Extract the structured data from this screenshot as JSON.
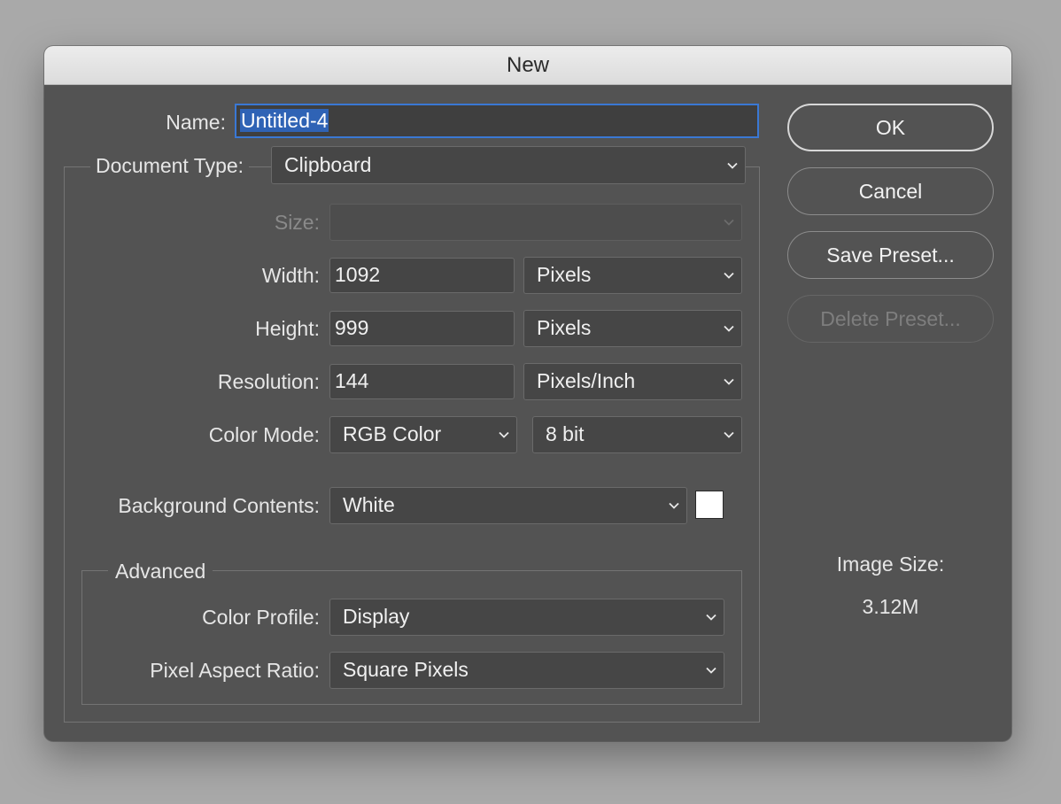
{
  "window": {
    "title": "New"
  },
  "form": {
    "name_label": "Name:",
    "name_value": "Untitled-4",
    "document_type_label": "Document Type:",
    "document_type_value": "Clipboard",
    "size_label": "Size:",
    "size_value": "",
    "width_label": "Width:",
    "width_value": "1092",
    "width_unit": "Pixels",
    "height_label": "Height:",
    "height_value": "999",
    "height_unit": "Pixels",
    "resolution_label": "Resolution:",
    "resolution_value": "144",
    "resolution_unit": "Pixels/Inch",
    "color_mode_label": "Color Mode:",
    "color_mode_value": "RGB Color",
    "bit_depth_value": "8 bit",
    "background_label": "Background Contents:",
    "background_value": "White",
    "background_swatch_color": "#ffffff"
  },
  "advanced": {
    "title": "Advanced",
    "color_profile_label": "Color Profile:",
    "color_profile_value": "Display",
    "pixel_aspect_label": "Pixel Aspect Ratio:",
    "pixel_aspect_value": "Square Pixels"
  },
  "buttons": {
    "ok": "OK",
    "cancel": "Cancel",
    "save_preset": "Save Preset...",
    "delete_preset": "Delete Preset..."
  },
  "image_size": {
    "label": "Image Size:",
    "value": "3.12M"
  },
  "icons": {
    "dropdown": "chevron-down-icon"
  },
  "colors": {
    "dialog_bg": "#535353",
    "focus_ring": "#3a78d4",
    "selection": "#2f63b5"
  }
}
